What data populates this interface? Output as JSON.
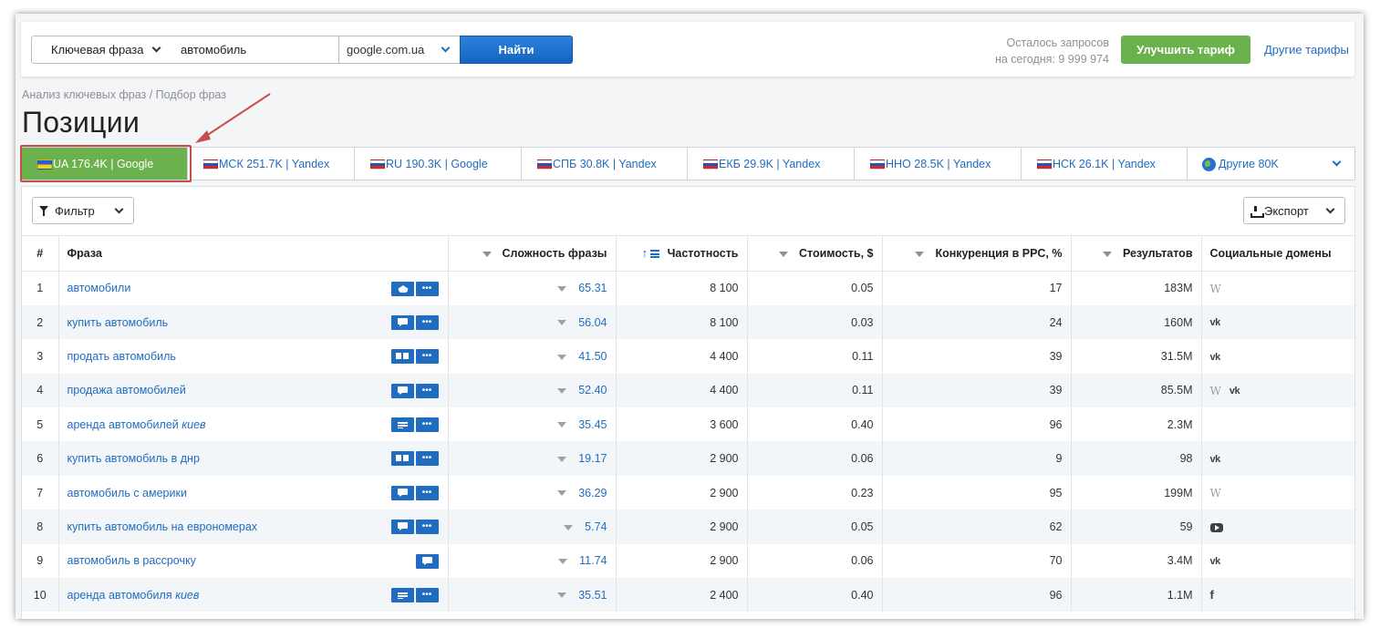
{
  "search": {
    "type_label": "Ключевая фраза",
    "query": "автомобиль",
    "database": "google.com.ua",
    "find_label": "Найти"
  },
  "quota": {
    "line1": "Осталось запросов",
    "line2": "на сегодня: 9 999 974"
  },
  "upgrade_label": "Улучшить тариф",
  "other_plans_label": "Другие тарифы",
  "breadcrumb": "Анализ ключевых фраз / Подбор фраз",
  "page_title": "Позиции",
  "tabs": [
    {
      "label": "UA 176.4K | Google",
      "flag": "ua"
    },
    {
      "label": "МСК 251.7K | Yandex",
      "flag": "ru"
    },
    {
      "label": "RU 190.3K | Google",
      "flag": "ru"
    },
    {
      "label": "СПБ 30.8K | Yandex",
      "flag": "ru"
    },
    {
      "label": "ЕКБ 29.9K | Yandex",
      "flag": "ru"
    },
    {
      "label": "ННО 28.5K | Yandex",
      "flag": "ru"
    },
    {
      "label": "НСК 26.1K | Yandex",
      "flag": "ru"
    },
    {
      "label": "Другие 80K",
      "flag": "globe"
    }
  ],
  "toolbar": {
    "filter_label": "Фильтр",
    "export_label": "Экспорт"
  },
  "columns": {
    "num": "#",
    "phrase": "Фраза",
    "difficulty": "Сложность фразы",
    "frequency": "Частотность",
    "cost": "Стоимость, $",
    "competition": "Конкуренция в PPC, %",
    "results": "Результатов",
    "social": "Социальные домены"
  },
  "rows": [
    {
      "n": "1",
      "phrase": "автомобили",
      "phrase_italic": "",
      "features": [
        "cap",
        "dots"
      ],
      "difficulty": "65.31",
      "frequency": "8 100",
      "cost": "0.05",
      "competition": "17",
      "results": "183M",
      "social": [
        "wikipedia"
      ]
    },
    {
      "n": "2",
      "phrase": "купить автомобиль",
      "phrase_italic": "",
      "features": [
        "chat",
        "dots"
      ],
      "difficulty": "56.04",
      "frequency": "8 100",
      "cost": "0.03",
      "competition": "24",
      "results": "160M",
      "social": [
        "vk"
      ]
    },
    {
      "n": "3",
      "phrase": "продать автомобиль",
      "phrase_italic": "",
      "features": [
        "cards",
        "dots"
      ],
      "difficulty": "41.50",
      "frequency": "4 400",
      "cost": "0.11",
      "competition": "39",
      "results": "31.5M",
      "social": [
        "vk"
      ]
    },
    {
      "n": "4",
      "phrase": "продажа автомобилей",
      "phrase_italic": "",
      "features": [
        "chat",
        "dots"
      ],
      "difficulty": "52.40",
      "frequency": "4 400",
      "cost": "0.11",
      "competition": "39",
      "results": "85.5M",
      "social": [
        "wikipedia",
        "vk"
      ]
    },
    {
      "n": "5",
      "phrase": "аренда автомобилей ",
      "phrase_italic": "киев",
      "features": [
        "lines",
        "dots"
      ],
      "difficulty": "35.45",
      "frequency": "3 600",
      "cost": "0.40",
      "competition": "96",
      "results": "2.3M",
      "social": []
    },
    {
      "n": "6",
      "phrase": "купить автомобиль в днр",
      "phrase_italic": "",
      "features": [
        "cards",
        "dots"
      ],
      "difficulty": "19.17",
      "frequency": "2 900",
      "cost": "0.06",
      "competition": "9",
      "results": "98",
      "social": [
        "vk"
      ]
    },
    {
      "n": "7",
      "phrase": "автомобиль с америки",
      "phrase_italic": "",
      "features": [
        "chat",
        "dots"
      ],
      "difficulty": "36.29",
      "frequency": "2 900",
      "cost": "0.23",
      "competition": "95",
      "results": "199M",
      "social": [
        "wikipedia"
      ]
    },
    {
      "n": "8",
      "phrase": "купить автомобиль на еврономерах",
      "phrase_italic": "",
      "features": [
        "chat",
        "dots"
      ],
      "difficulty": "5.74",
      "frequency": "2 900",
      "cost": "0.05",
      "competition": "62",
      "results": "59",
      "social": [
        "youtube"
      ]
    },
    {
      "n": "9",
      "phrase": "автомобиль в рассрочку",
      "phrase_italic": "",
      "features": [
        "chat"
      ],
      "difficulty": "11.74",
      "frequency": "2 900",
      "cost": "0.06",
      "competition": "70",
      "results": "3.4M",
      "social": [
        "vk"
      ]
    },
    {
      "n": "10",
      "phrase": "аренда автомобиля ",
      "phrase_italic": "киев",
      "features": [
        "lines",
        "dots"
      ],
      "difficulty": "35.51",
      "frequency": "2 400",
      "cost": "0.40",
      "competition": "96",
      "results": "1.1M",
      "social": [
        "facebook"
      ]
    }
  ],
  "colors": {
    "link": "#1f6cc0",
    "active_tab": "#6bb24e",
    "find_button": "#1c6fc4",
    "annotation": "#c94c4c",
    "zebra": "#f3f6f9"
  }
}
